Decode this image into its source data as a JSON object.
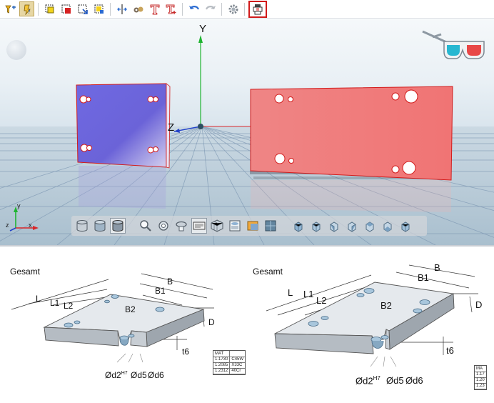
{
  "toolbar": {
    "buttons": [
      {
        "name": "filter-icon",
        "pressed": false
      },
      {
        "name": "hint-icon",
        "pressed": true
      },
      {
        "name": "select-all-icon",
        "pressed": false
      },
      {
        "name": "select-box-red-icon",
        "pressed": false
      },
      {
        "name": "select-box-blue-icon",
        "pressed": false
      },
      {
        "name": "select-box-yellow-icon",
        "pressed": false
      },
      {
        "name": "split-view-icon",
        "pressed": false
      },
      {
        "name": "measure-icon",
        "pressed": false
      },
      {
        "name": "text-icon",
        "pressed": false
      },
      {
        "name": "text-add-icon",
        "pressed": false
      },
      {
        "name": "undo-icon",
        "pressed": false
      },
      {
        "name": "redo-icon",
        "pressed": false
      },
      {
        "name": "settings-icon",
        "pressed": false
      },
      {
        "name": "export-3d-icon",
        "pressed": false,
        "selected": true
      }
    ]
  },
  "viewport": {
    "axis_y": "Y",
    "axis_z": "Z",
    "mini_axes": {
      "x": "x",
      "y": "y",
      "z": "z"
    },
    "bottom_bar": [
      "view-cylinder-wire-icon",
      "view-cylinder-shaded-icon",
      "view-cylinder-dark-icon",
      "zoom-icon",
      "zoom-fit-icon",
      "rotate-icon",
      "section-icon",
      "mesh-icon",
      "drawing-icon",
      "grid-plane-icon",
      "texture-icon",
      "view-front-icon",
      "view-back-icon",
      "view-left-icon",
      "view-right-icon",
      "view-top-icon",
      "view-bottom-icon",
      "view-iso-icon"
    ],
    "colors": {
      "blue_plate": "#6b63d8",
      "red_plate": "#ee7b7b",
      "grid": "#7e98b3",
      "floor": "#b8ccd9"
    }
  },
  "drawings": [
    {
      "title": "Gesamt",
      "labels": {
        "B": "B",
        "B1": "B1",
        "B2": "B2",
        "L": "L",
        "L1": "L1",
        "L2": "L2",
        "D": "D",
        "t6": "t6",
        "d2": "Ød2",
        "h7": "H7",
        "d5": "Ød5",
        "d6": "Ød6"
      },
      "mat": {
        "header": "MAT",
        "rows": [
          [
            "1.1730",
            "C45W"
          ],
          [
            "1.2085",
            "X33C"
          ],
          [
            "1.2312",
            "40Cr"
          ]
        ]
      }
    },
    {
      "title": "Gesamt",
      "labels": {
        "B": "B",
        "B1": "B1",
        "B2": "B2",
        "L": "L",
        "L1": "L1",
        "L2": "L2",
        "D": "D",
        "t6": "t6",
        "d2": "Ød2",
        "h7": "H7",
        "d5": "Ød5",
        "d6": "Ød6"
      },
      "mat": {
        "header": "MA",
        "rows": [
          [
            "1.17"
          ],
          [
            "1.20"
          ],
          [
            "1.23"
          ]
        ]
      }
    }
  ]
}
